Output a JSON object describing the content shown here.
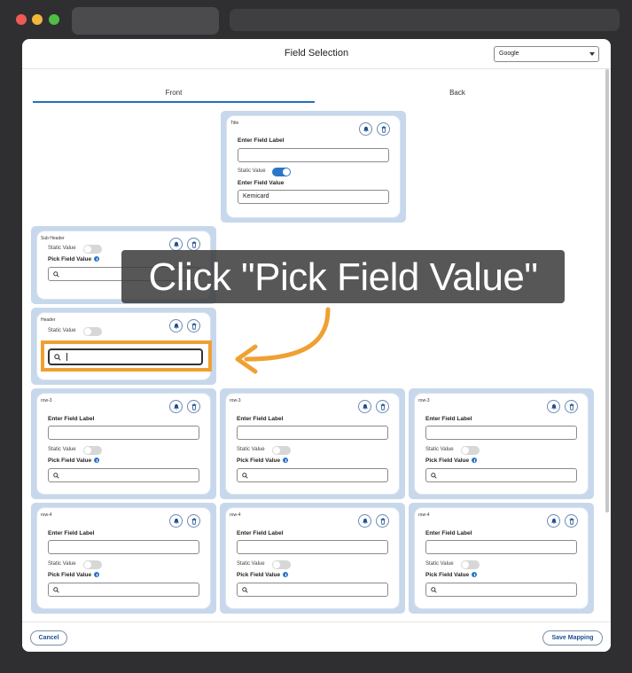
{
  "window": {
    "controls": [
      "close",
      "minimize",
      "maximize"
    ]
  },
  "header": {
    "title": "Field Selection",
    "select_value": "Google"
  },
  "tabs": [
    {
      "label": "Front"
    },
    {
      "label": "Back"
    }
  ],
  "overlay": {
    "instruction": "Click \"Pick Field Value\""
  },
  "cards": {
    "title": {
      "name": "Title",
      "label_heading": "Enter Field Label",
      "label_value": "",
      "static_label": "Static Value",
      "static_on": true,
      "value_heading": "Enter Field Value",
      "value": "Kemicard"
    },
    "subheader": {
      "name": "Sub Header",
      "static_label": "Static Value",
      "pick_label": "Pick Field Value"
    },
    "header_card": {
      "name": "Header",
      "static_label": "Static Value"
    },
    "row3": [
      {
        "name": "row-3",
        "label_heading": "Enter Field Label",
        "static_label": "Static Value",
        "pick_label": "Pick Field Value"
      },
      {
        "name": "row-3",
        "label_heading": "Enter Field Label",
        "static_label": "Static Value",
        "pick_label": "Pick Field Value"
      },
      {
        "name": "row-3",
        "label_heading": "Enter Field Label",
        "static_label": "Static Value",
        "pick_label": "Pick Field Value"
      }
    ],
    "row4": [
      {
        "name": "row-4",
        "label_heading": "Enter Field Label",
        "static_label": "Static Value",
        "pick_label": "Pick Field Value"
      },
      {
        "name": "row-4",
        "label_heading": "Enter Field Label",
        "static_label": "Static Value",
        "pick_label": "Pick Field Value"
      },
      {
        "name": "row-4",
        "label_heading": "Enter Field Label",
        "static_label": "Static Value",
        "pick_label": "Pick Field Value"
      }
    ]
  },
  "footer": {
    "cancel_label": "Cancel",
    "save_label": "Save Mapping"
  },
  "colors": {
    "accent": "#2b76c7",
    "highlight": "#f0a033",
    "card_bg": "#c7d8ec"
  }
}
